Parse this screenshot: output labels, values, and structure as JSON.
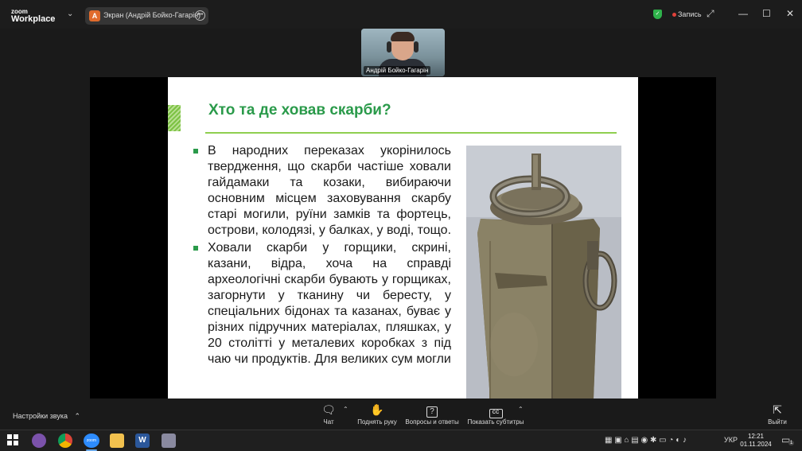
{
  "app": {
    "logo_line1": "zoom",
    "logo_line2": "Workplace",
    "share_avatar_letter": "А",
    "share_label": "Экран (Андрій Бойко-Гагарін)",
    "record_label": "Запись",
    "brand_color": "#2a9a4a",
    "record_color": "#e0413a"
  },
  "participant": {
    "name": "Андрій Бойко-Гагарін"
  },
  "slide": {
    "title": "Хто та де ховав скарби?",
    "bullets": [
      "В народних переказах укорінилось твердження, що скарби частіше ховали гайдамаки та козаки, вибираючи основним місцем заховування скарбу старі могили, руїни замків та фортець, острови, колодязі, у балках, у воді, тощо.",
      "Ховали скарби у горщики, скрині, казани, відра, хоча на справді археологічні скарби бувають у горщиках, загорнути у тканину чи бересту, у спеціальних бідонах та казанах, буває у різних підручних матеріалах, пляшках, у 20 столітті у металевих коробках з під чаю чи продуктів. Для великих сум могли"
    ]
  },
  "toolbar": {
    "sound_settings": "Настройки звука",
    "chat": "Чат",
    "raise_hand": "Поднять руку",
    "qa": "Вопросы и ответы",
    "captions": "Показать субтитры",
    "captions_icon_text": "CC",
    "leave": "Выйти"
  },
  "taskbar": {
    "language": "УКР",
    "time": "12:21",
    "date": "01.11.2024",
    "notification_count": "1",
    "zoom_icon_text": "zoom"
  }
}
